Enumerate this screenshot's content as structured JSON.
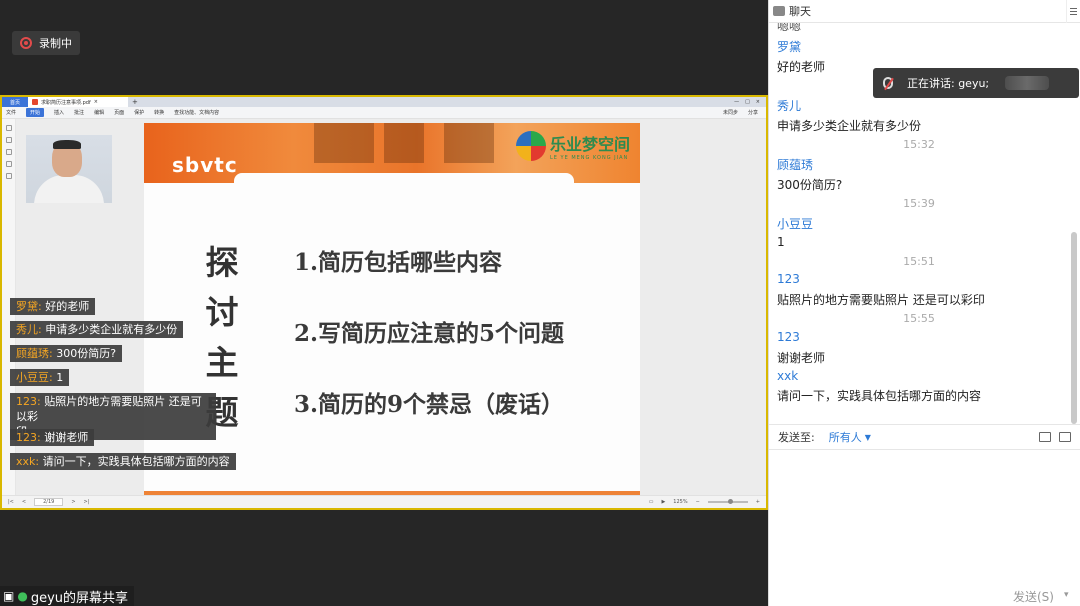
{
  "recording": {
    "label": "录制中"
  },
  "wps": {
    "home_tab": "首页",
    "doc_tab": "求职简历注意事项.pdf",
    "toolbar": [
      "文件",
      "开始",
      "插入",
      "批注",
      "编辑",
      "页面",
      "保护",
      "转换"
    ],
    "active_tool": "开始",
    "search": "查找功能、文档内容",
    "right_tools": [
      "未同步",
      "分享"
    ],
    "status": {
      "page": "2/19",
      "zoom": "125%"
    }
  },
  "slide": {
    "logo_left": "sbvtc",
    "brand_cn": "乐业梦空间",
    "brand_en": "LE YE MENG KONG JIAN",
    "vertical_title": [
      "探",
      "讨",
      "主",
      "题"
    ],
    "points": [
      "1.简历包括哪些内容",
      "2.写简历应注意的5个问题",
      "3.简历的9个禁忌（废话）"
    ]
  },
  "overlay_messages": [
    {
      "name": "罗黛:",
      "text": " 好的老师"
    },
    {
      "name": "秀儿:",
      "text": " 申请多少类企业就有多少份"
    },
    {
      "name": "顾蕴琇:",
      "text": " 300份简历?"
    },
    {
      "name": "小豆豆:",
      "text": " 1"
    },
    {
      "name": "123:",
      "text": " 贴照片的地方需要贴照片 还是可以彩",
      "text2": "印"
    },
    {
      "name": "123:",
      "text": " 谢谢老师"
    },
    {
      "name": "xxk:",
      "text": " 请问一下，实践具体包括哪方面的内容"
    }
  ],
  "share_label": "geyu的屏幕共享",
  "chat": {
    "title": "聊天",
    "partial_top": "嗯嗯",
    "messages": [
      {
        "name": "罗黛",
        "text": "好的老师"
      },
      {
        "name": "秀儿",
        "text": "申请多少类企业就有多少份"
      },
      {
        "time": "15:32"
      },
      {
        "name": "顾蕴琇",
        "text": "300份简历?"
      },
      {
        "time": "15:39"
      },
      {
        "name": "小豆豆",
        "text": "1"
      },
      {
        "time": "15:51"
      },
      {
        "name": "123",
        "text": "贴照片的地方需要贴照片 还是可以彩印"
      },
      {
        "time": "15:55"
      },
      {
        "name": "123",
        "text": "谢谢老师"
      },
      {
        "name": "xxk",
        "text": "请问一下，实践具体包括哪方面的内容"
      }
    ],
    "send_to_label": "发送至:",
    "send_to_value": "所有人",
    "send_button": "发送(S)"
  },
  "speaking": {
    "label": "正在讲话: geyu;"
  }
}
